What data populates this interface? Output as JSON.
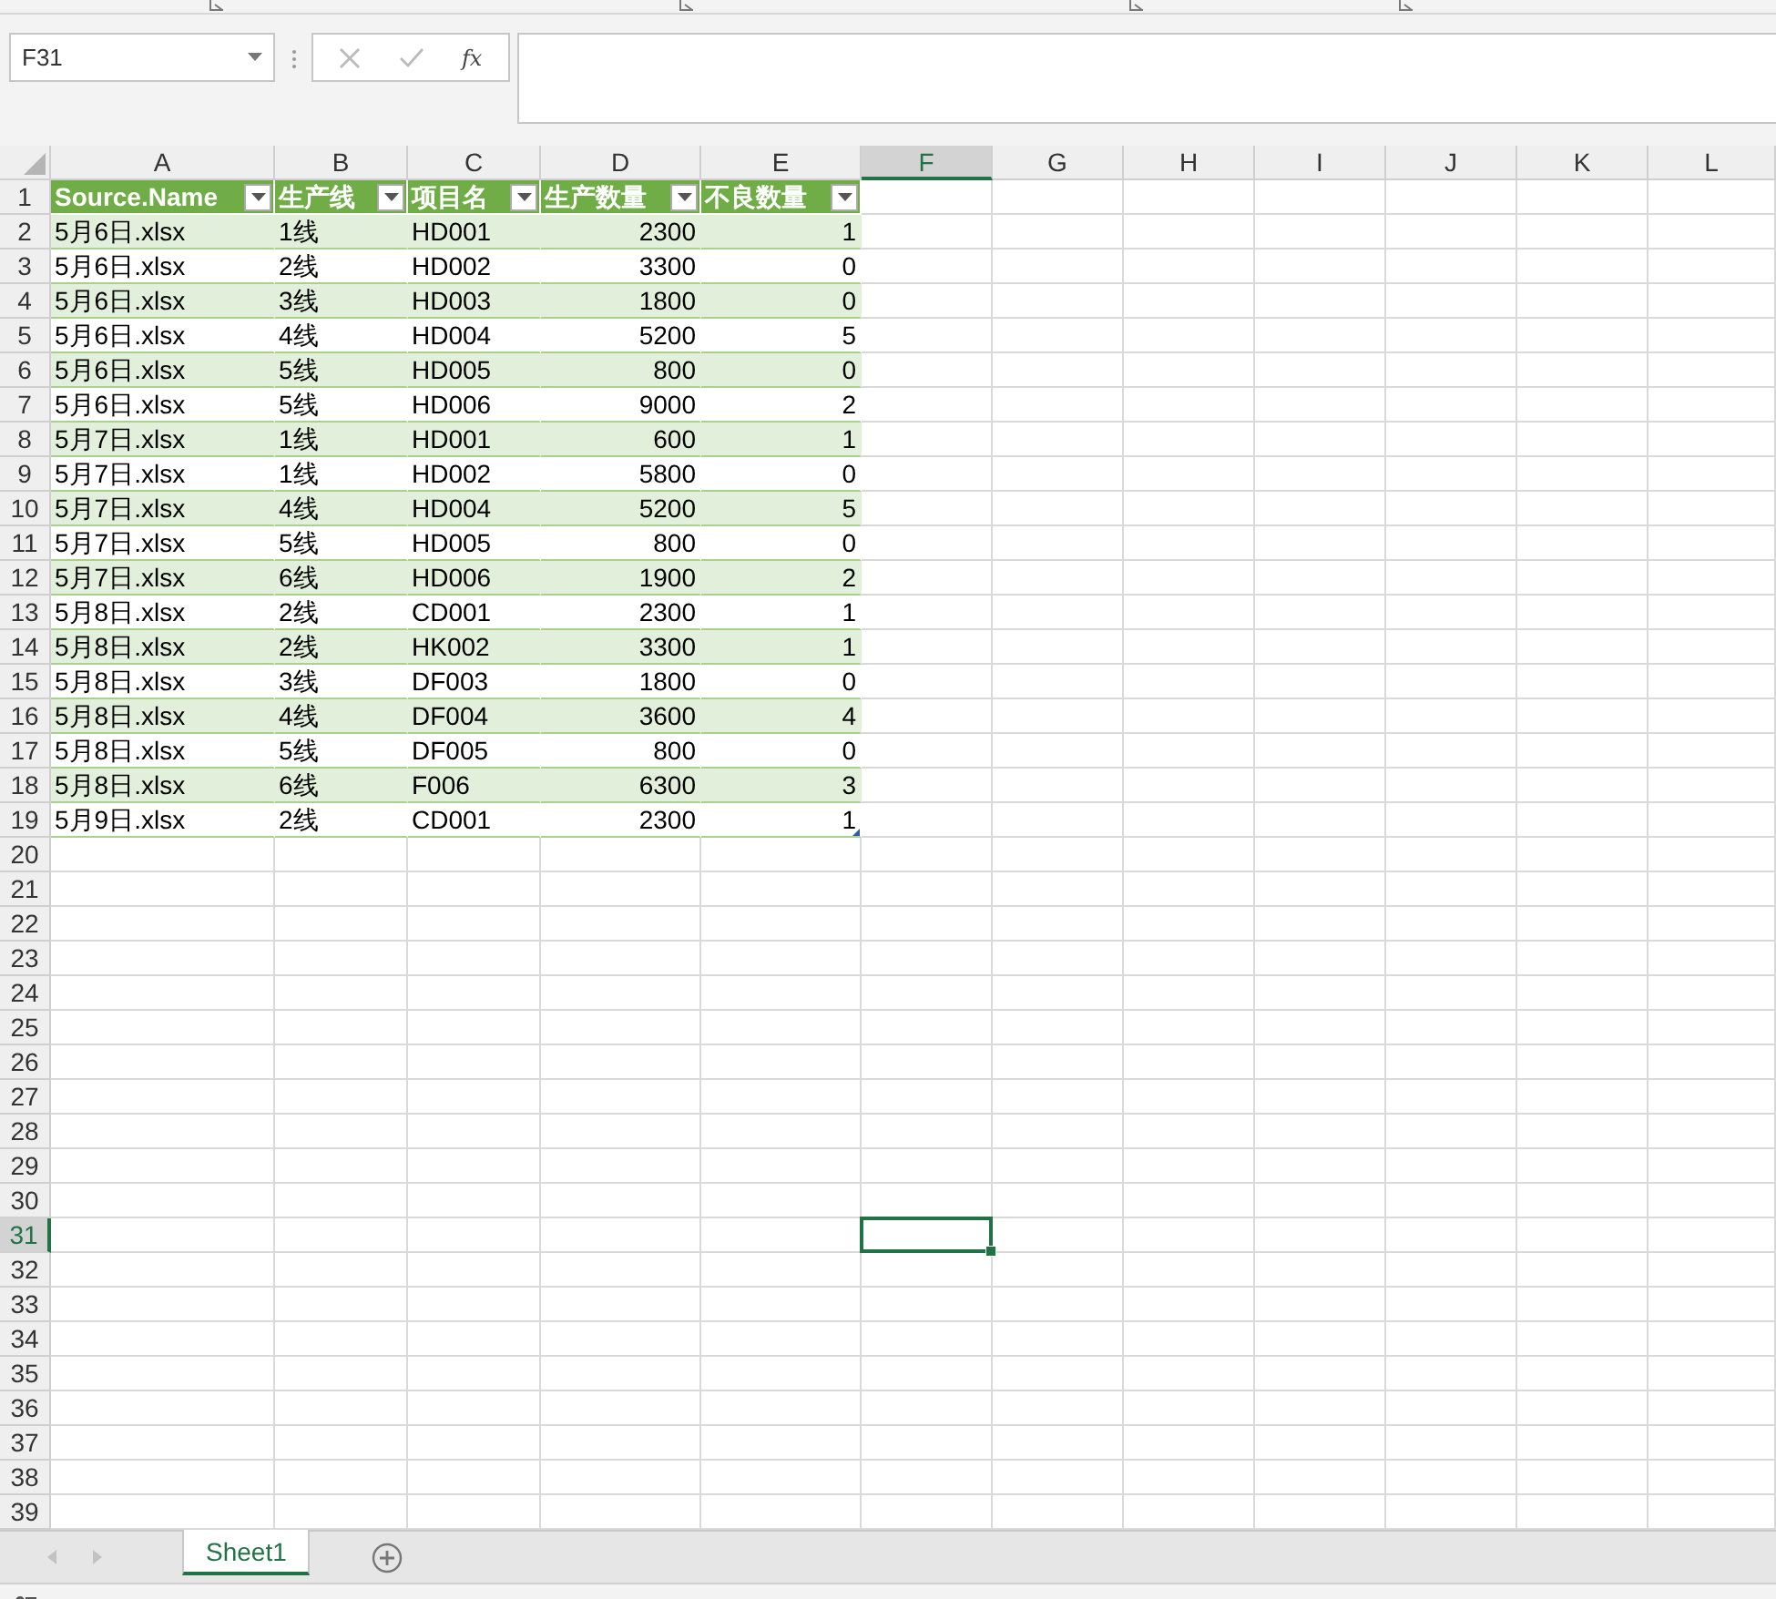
{
  "name_box": {
    "value": "F31"
  },
  "formula_bar": {
    "function_label": "fx",
    "cancel_disabled": true,
    "enter_disabled": true
  },
  "columns": [
    {
      "label": "A",
      "selected": false
    },
    {
      "label": "B",
      "selected": false
    },
    {
      "label": "C",
      "selected": false
    },
    {
      "label": "D",
      "selected": false
    },
    {
      "label": "E",
      "selected": false
    },
    {
      "label": "F",
      "selected": true
    },
    {
      "label": "G",
      "selected": false
    },
    {
      "label": "H",
      "selected": false
    },
    {
      "label": "I",
      "selected": false
    },
    {
      "label": "J",
      "selected": false
    },
    {
      "label": "K",
      "selected": false
    },
    {
      "label": "L",
      "selected": false
    }
  ],
  "grid_rows": [
    {
      "label": "1",
      "selected": false
    },
    {
      "label": "2",
      "selected": false
    },
    {
      "label": "3",
      "selected": false
    },
    {
      "label": "4",
      "selected": false
    },
    {
      "label": "5",
      "selected": false
    },
    {
      "label": "6",
      "selected": false
    },
    {
      "label": "7",
      "selected": false
    },
    {
      "label": "8",
      "selected": false
    },
    {
      "label": "9",
      "selected": false
    },
    {
      "label": "10",
      "selected": false
    },
    {
      "label": "11",
      "selected": false
    },
    {
      "label": "12",
      "selected": false
    },
    {
      "label": "13",
      "selected": false
    },
    {
      "label": "14",
      "selected": false
    },
    {
      "label": "15",
      "selected": false
    },
    {
      "label": "16",
      "selected": false
    },
    {
      "label": "17",
      "selected": false
    },
    {
      "label": "18",
      "selected": false
    },
    {
      "label": "19",
      "selected": false
    },
    {
      "label": "20",
      "selected": false
    },
    {
      "label": "21",
      "selected": false
    },
    {
      "label": "22",
      "selected": false
    },
    {
      "label": "23",
      "selected": false
    },
    {
      "label": "24",
      "selected": false
    },
    {
      "label": "25",
      "selected": false
    },
    {
      "label": "26",
      "selected": false
    },
    {
      "label": "27",
      "selected": false
    },
    {
      "label": "28",
      "selected": false
    },
    {
      "label": "29",
      "selected": false
    },
    {
      "label": "30",
      "selected": false
    },
    {
      "label": "31",
      "selected": true
    },
    {
      "label": "32",
      "selected": false
    },
    {
      "label": "33",
      "selected": false
    },
    {
      "label": "34",
      "selected": false
    },
    {
      "label": "35",
      "selected": false
    },
    {
      "label": "36",
      "selected": false
    },
    {
      "label": "37",
      "selected": false
    },
    {
      "label": "38",
      "selected": false
    },
    {
      "label": "39",
      "selected": false
    }
  ],
  "table": {
    "columns": [
      {
        "label": "Source.Name",
        "kind": "text"
      },
      {
        "label": "生产线",
        "kind": "text"
      },
      {
        "label": "项目名",
        "kind": "text"
      },
      {
        "label": "生产数量",
        "kind": "number"
      },
      {
        "label": "不良数量",
        "kind": "number"
      }
    ],
    "rows": [
      [
        "5月6日.xlsx",
        "1线",
        "HD001",
        "2300",
        "1"
      ],
      [
        "5月6日.xlsx",
        "2线",
        "HD002",
        "3300",
        "0"
      ],
      [
        "5月6日.xlsx",
        "3线",
        "HD003",
        "1800",
        "0"
      ],
      [
        "5月6日.xlsx",
        "4线",
        "HD004",
        "5200",
        "5"
      ],
      [
        "5月6日.xlsx",
        "5线",
        "HD005",
        "800",
        "0"
      ],
      [
        "5月6日.xlsx",
        "5线",
        "HD006",
        "9000",
        "2"
      ],
      [
        "5月7日.xlsx",
        "1线",
        "HD001",
        "600",
        "1"
      ],
      [
        "5月7日.xlsx",
        "1线",
        "HD002",
        "5800",
        "0"
      ],
      [
        "5月7日.xlsx",
        "4线",
        "HD004",
        "5200",
        "5"
      ],
      [
        "5月7日.xlsx",
        "5线",
        "HD005",
        "800",
        "0"
      ],
      [
        "5月7日.xlsx",
        "6线",
        "HD006",
        "1900",
        "2"
      ],
      [
        "5月8日.xlsx",
        "2线",
        "CD001",
        "2300",
        "1"
      ],
      [
        "5月8日.xlsx",
        "2线",
        "HK002",
        "3300",
        "1"
      ],
      [
        "5月8日.xlsx",
        "3线",
        "DF003",
        "1800",
        "0"
      ],
      [
        "5月8日.xlsx",
        "4线",
        "DF004",
        "3600",
        "4"
      ],
      [
        "5月8日.xlsx",
        "5线",
        "DF005",
        "800",
        "0"
      ],
      [
        "5月8日.xlsx",
        "6线",
        "F006",
        "6300",
        "3"
      ],
      [
        "5月9日.xlsx",
        "2线",
        "CD001",
        "2300",
        "1"
      ]
    ]
  },
  "sheet_tabs": [
    {
      "label": "Sheet1",
      "selected": true
    }
  ]
}
